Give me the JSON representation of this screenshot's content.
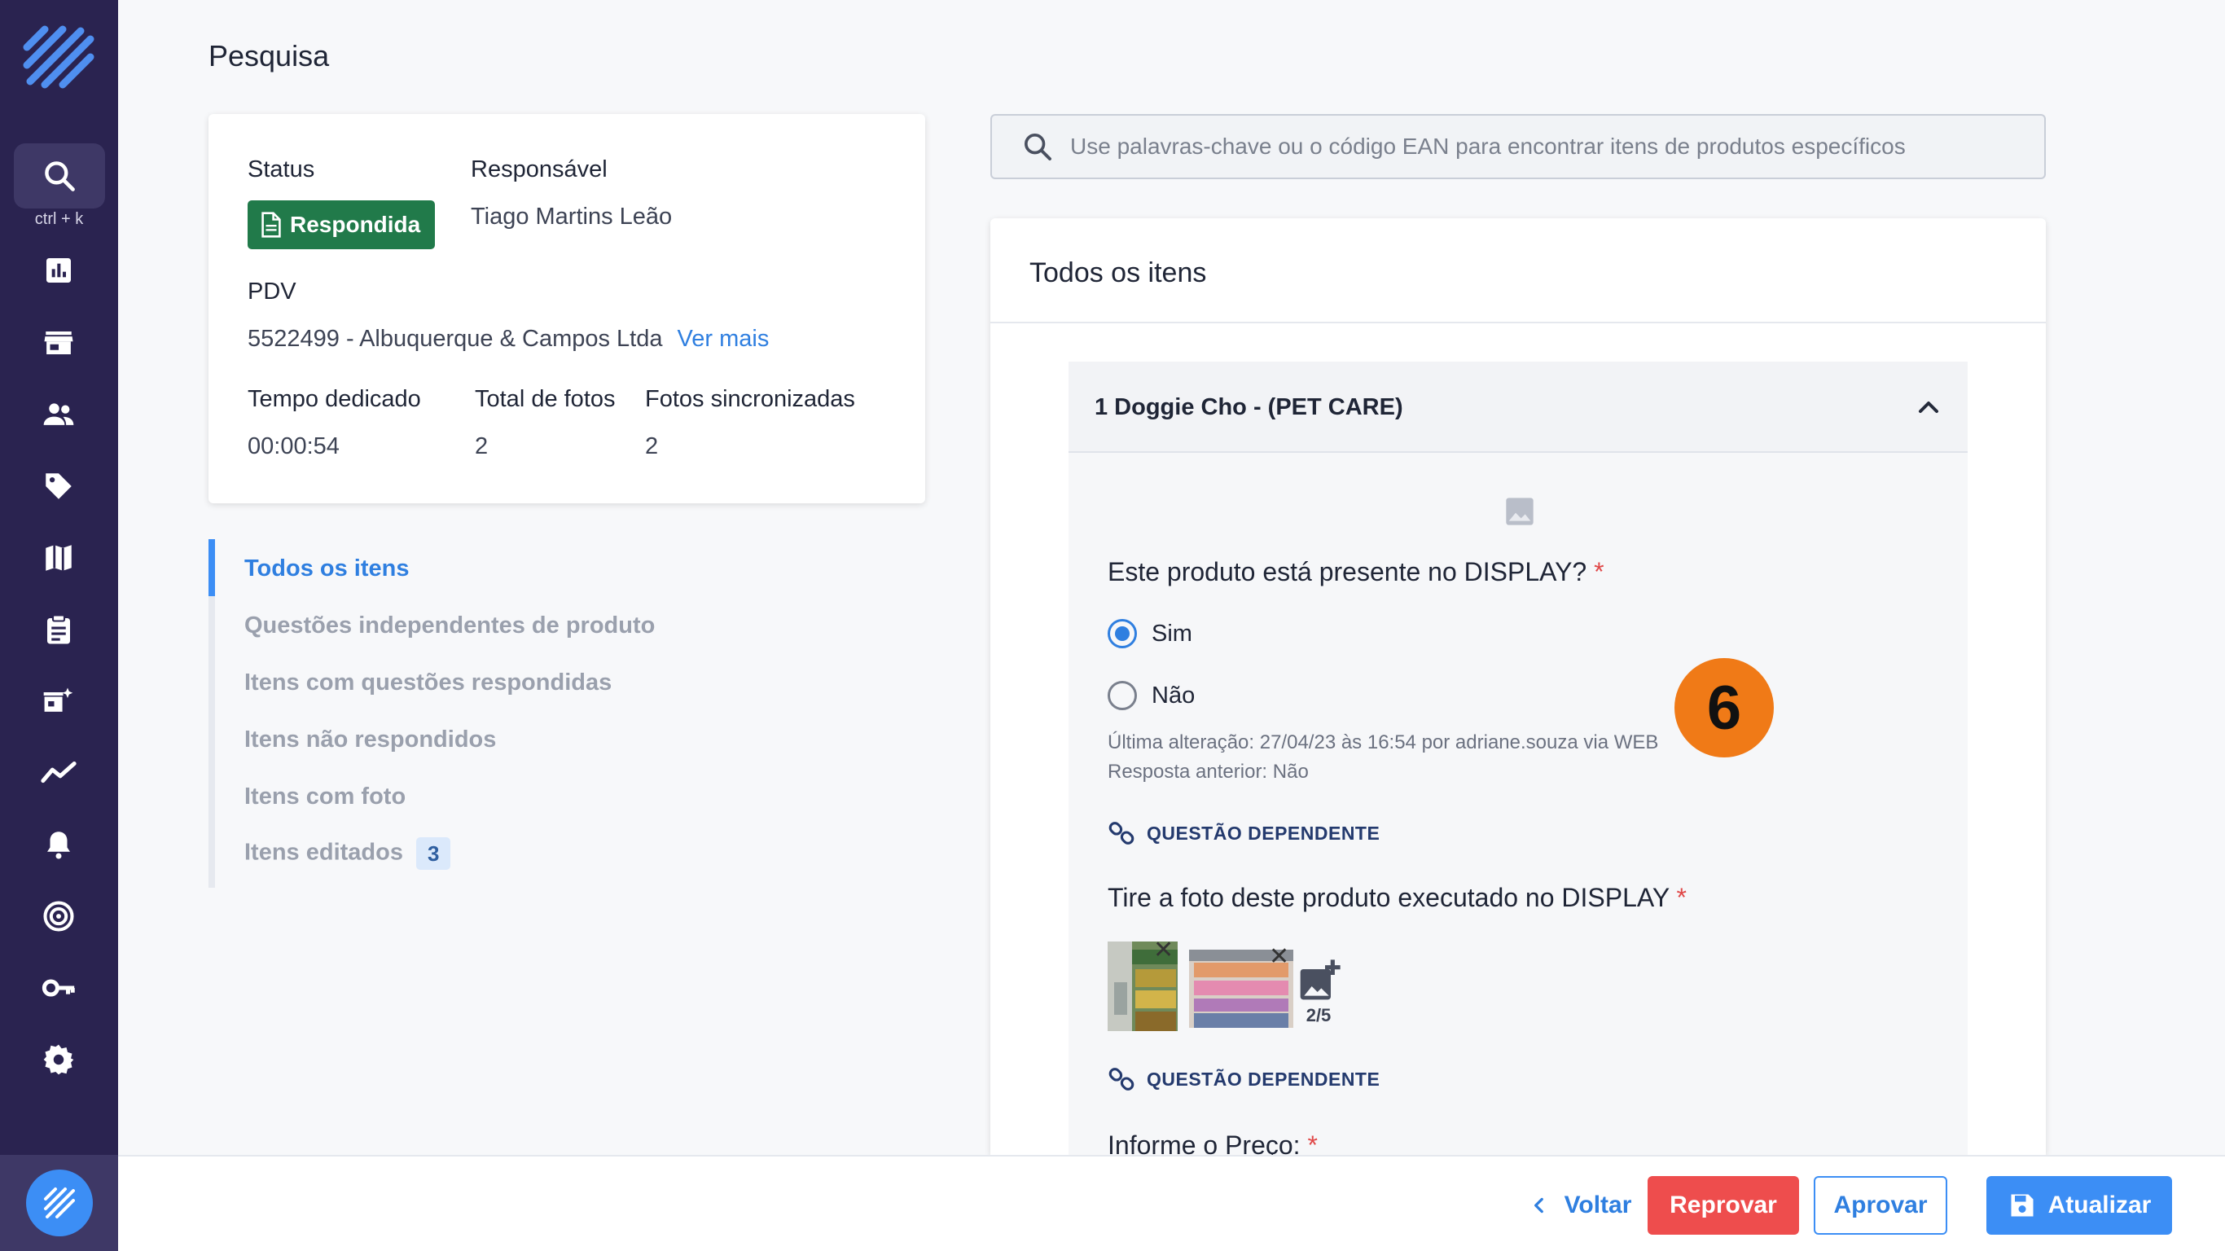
{
  "sidebar": {
    "shortcut": "ctrl + k",
    "icons": [
      "search-icon",
      "chart-icon",
      "store-icon",
      "users-icon",
      "tag-icon",
      "map-icon",
      "clipboard-icon",
      "add-business-icon",
      "trend-icon",
      "bell-icon",
      "target-icon",
      "key-icon",
      "gear-icon"
    ]
  },
  "page": {
    "title": "Pesquisa"
  },
  "info": {
    "status_label": "Status",
    "status_value": "Respondida",
    "responsible_label": "Responsável",
    "responsible_value": "Tiago Martins Leão",
    "pdv_label": "PDV",
    "pdv_value": "5522499 - Albuquerque & Campos Ltda",
    "see_more": "Ver mais",
    "time_label": "Tempo dedicado",
    "time_value": "00:00:54",
    "photos_label": "Total de fotos",
    "photos_value": "2",
    "synced_label": "Fotos sincronizadas",
    "synced_value": "2"
  },
  "filters": {
    "items": [
      {
        "label": "Todos os itens"
      },
      {
        "label": "Questões independentes de produto"
      },
      {
        "label": "Itens com questões respondidas"
      },
      {
        "label": "Itens não respondidos"
      },
      {
        "label": "Itens com foto"
      },
      {
        "label": "Itens editados",
        "count": "3"
      }
    ]
  },
  "search": {
    "placeholder": "Use palavras-chave ou o código EAN para encontrar itens de produtos específicos"
  },
  "items_panel": {
    "title": "Todos os itens",
    "product": {
      "name": "1 Doggie Cho - (PET CARE)",
      "q1": "Este produto está presente no DISPLAY?",
      "required_mark": "*",
      "opt_yes": "Sim",
      "opt_no": "Não",
      "last_change": "Última alteração: 27/04/23 às 16:54 por adriane.souza via WEB",
      "previous_answer": "Resposta anterior:  Não",
      "dependent_label": "QUESTÃO DEPENDENTE",
      "q2": "Tire a foto deste produto executado no DISPLAY",
      "photo_count": "2/5",
      "q3": "Informe o Preço:"
    }
  },
  "step_badge": "6",
  "footer": {
    "back": "Voltar",
    "reject": "Reprovar",
    "approve": "Aprovar",
    "update": "Atualizar"
  },
  "colors": {
    "sidebar_bg": "#2a2350",
    "accent": "#3c8ef5",
    "success": "#217a4a",
    "danger": "#ee4d4d",
    "badge": "#f07a17"
  }
}
